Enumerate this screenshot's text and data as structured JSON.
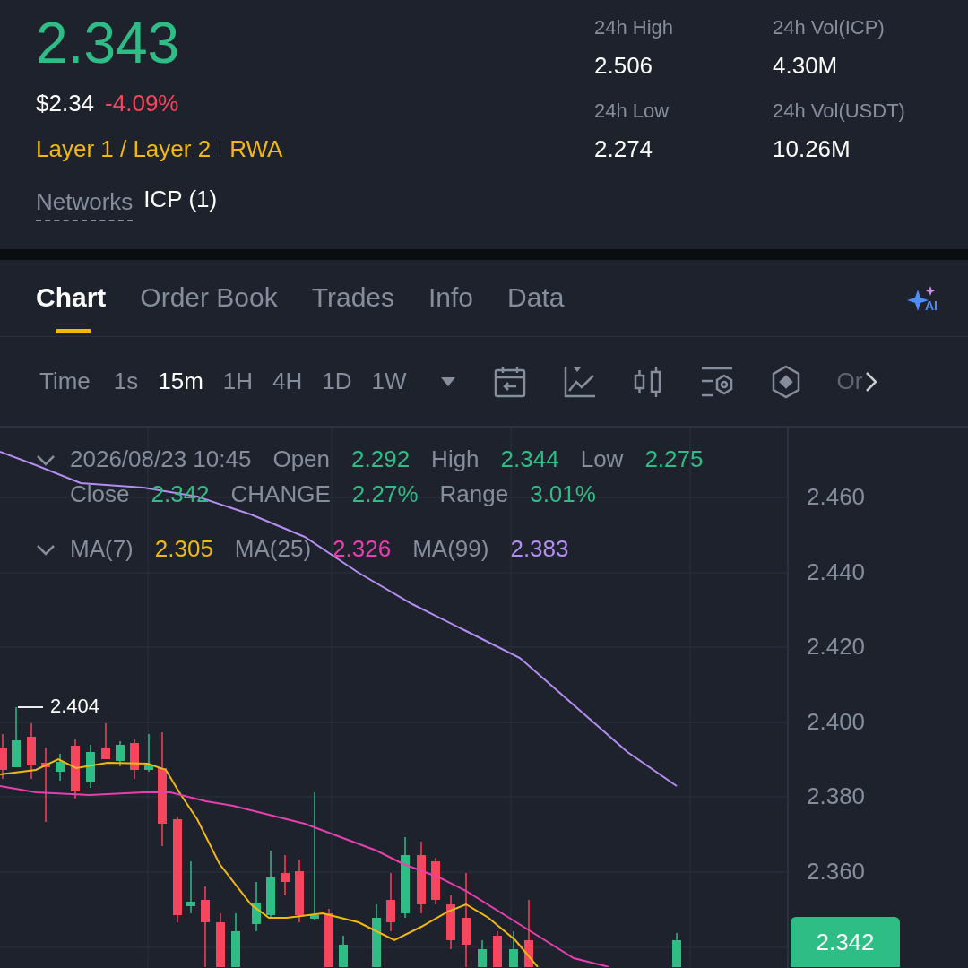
{
  "ticker": {
    "last_price": "2.343",
    "usd_price": "$2.34",
    "change": "-4.09%",
    "tags": [
      "Layer 1 / Layer 2",
      "RWA"
    ],
    "networks_label": "Networks",
    "networks_value": "ICP (1)"
  },
  "stats": [
    {
      "label": "24h High",
      "value": "2.506"
    },
    {
      "label": "24h Vol(ICP)",
      "value": "4.30M"
    },
    {
      "label": "24h Low",
      "value": "2.274"
    },
    {
      "label": "24h Vol(USDT)",
      "value": "10.26M"
    }
  ],
  "tabs": [
    {
      "label": "Chart",
      "selected": true
    },
    {
      "label": "Order Book",
      "selected": false
    },
    {
      "label": "Trades",
      "selected": false
    },
    {
      "label": "Info",
      "selected": false
    },
    {
      "label": "Data",
      "selected": false
    }
  ],
  "ai_label": "AI",
  "intervals": {
    "label": "Time",
    "items": [
      {
        "label": "1s",
        "selected": false
      },
      {
        "label": "15m",
        "selected": true
      },
      {
        "label": "1H",
        "selected": false
      },
      {
        "label": "4H",
        "selected": false
      },
      {
        "label": "1D",
        "selected": false
      },
      {
        "label": "1W",
        "selected": false
      }
    ],
    "overflow_label": "Or"
  },
  "ohlc": {
    "expanded": true,
    "date": "2026/08/23 10:45",
    "fields": [
      {
        "label": "Open",
        "value": "2.292"
      },
      {
        "label": "High",
        "value": "2.344"
      },
      {
        "label": "Low",
        "value": "2.275"
      },
      {
        "label": "Close",
        "value": "2.342"
      },
      {
        "label": "CHANGE",
        "value": "2.27%"
      },
      {
        "label": "Range",
        "value": "3.01%"
      }
    ]
  },
  "moving_averages": {
    "expanded": true,
    "items": [
      {
        "label": "MA(7)",
        "value": "2.305",
        "color": "#f0b90b"
      },
      {
        "label": "MA(25)",
        "value": "2.326",
        "color": "#e83fae"
      },
      {
        "label": "MA(99)",
        "value": "2.383",
        "color": "#b58df1"
      }
    ]
  },
  "chart": {
    "price_axis": [
      "2.460",
      "2.440",
      "2.420",
      "2.400",
      "2.380",
      "2.360"
    ],
    "high_marker": "2.404",
    "last_price_tag": "2.342"
  }
}
